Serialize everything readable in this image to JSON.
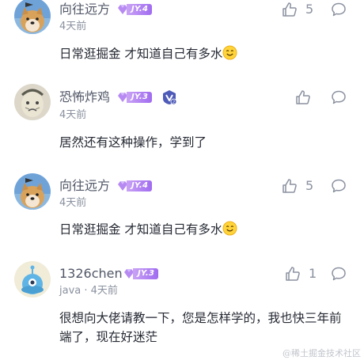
{
  "comments": [
    {
      "username": "向往远方",
      "level": "JY.4",
      "meta": "4天前",
      "text": "日常逛掘金 才知道自己有多水",
      "likes": "5"
    },
    {
      "username": "恐怖炸鸡",
      "level": "JY.3",
      "meta": "4天前",
      "text": "居然还有这种操作，学到了",
      "likes": ""
    },
    {
      "username": "向往远方",
      "level": "JY.4",
      "meta": "4天前",
      "text": "日常逛掘金 才知道自己有多水",
      "likes": "5"
    },
    {
      "username": "1326chen",
      "level": "JY.3",
      "meta": "java · 4天前",
      "text": "很想向大佬请教一下，您是怎样学的，我也快三年前端了，现在好迷茫",
      "likes": "1"
    }
  ],
  "icons": {
    "like": "thumbs-up-icon",
    "reply": "comment-bubble-icon",
    "emoji": "smile-emoji-icon",
    "badge": "vip-badge-icon"
  },
  "colors": {
    "level_badge": "#a06cf0",
    "username": "#515767",
    "meta": "#8a919f"
  },
  "watermark": "@稀土掘金技术社区"
}
